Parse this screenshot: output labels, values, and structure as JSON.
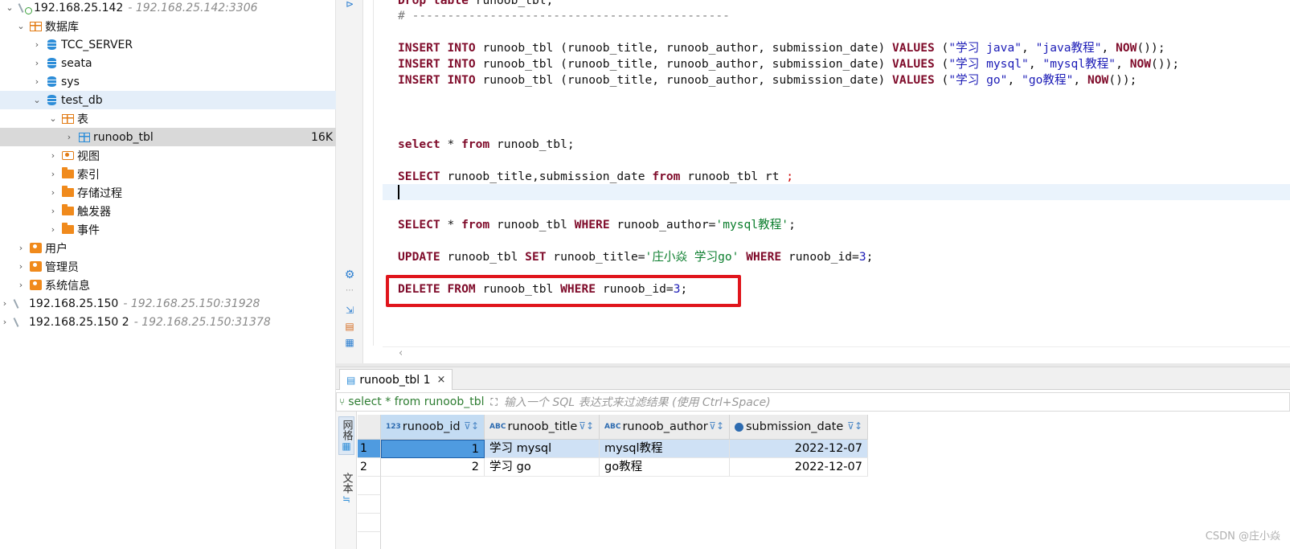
{
  "navigator": {
    "rows": [
      {
        "label": "192.168.25.142",
        "addr": "- 192.168.25.142:3306"
      },
      {
        "label": "数据库"
      },
      {
        "label": "TCC_SERVER"
      },
      {
        "label": "seata"
      },
      {
        "label": "sys"
      },
      {
        "label": "test_db"
      },
      {
        "label": "表"
      },
      {
        "label": "runoob_tbl",
        "size": "16K"
      },
      {
        "label": "视图"
      },
      {
        "label": "索引"
      },
      {
        "label": "存储过程"
      },
      {
        "label": "触发器"
      },
      {
        "label": "事件"
      },
      {
        "label": "用户"
      },
      {
        "label": "管理员"
      },
      {
        "label": "系统信息"
      },
      {
        "label": "192.168.25.150",
        "addr": "- 192.168.25.150:31928"
      },
      {
        "label": "192.168.25.150 2",
        "addr": "- 192.168.25.150:31378"
      }
    ]
  },
  "editor": {
    "line0": {
      "kw": "Drop table",
      "rest": " runoob_tbl;"
    },
    "line1": "# ---------------------------------------------",
    "insert": {
      "kw1": "INSERT INTO",
      "tbl": " runoob_tbl (runoob_title, runoob_author, submission_date) ",
      "kw2": "VALUES",
      "open": " (",
      "rows": [
        {
          "s1": "\"学习 java\"",
          "s2": "\"java教程\""
        },
        {
          "s1": "\"学习 mysql\"",
          "s2": "\"mysql教程\""
        },
        {
          "s1": "\"学习 go\"",
          "s2": "\"go教程\""
        }
      ],
      "sep": ", ",
      "now": "NOW",
      "close": "());"
    },
    "select_all": {
      "kw1": "select",
      "mid": " * ",
      "kw2": "from",
      "rest": " runoob_tbl;"
    },
    "select_cols": {
      "kw1": "SELECT",
      "mid": " runoob_title,submission_date ",
      "kw2": "from",
      "rest": " runoob_tbl rt ",
      "semi": ";"
    },
    "select_where": {
      "kw1": "SELECT",
      "mid": " * ",
      "kw2": "from",
      "tbl": " runoob_tbl ",
      "kw3": "WHERE",
      "col": " runoob_author=",
      "val": "'mysql教程'",
      "semi": ";"
    },
    "update": {
      "kw1": "UPDATE",
      "tbl": " runoob_tbl ",
      "kw2": "SET",
      "col": " runoob_title=",
      "val": "'庄小焱 学习go'",
      "sp": " ",
      "kw3": "WHERE",
      "col2": " runoob_id=",
      "num": "3",
      "semi": ";"
    },
    "delete": {
      "kw1": "DELETE FROM",
      "tbl": " runoob_tbl ",
      "kw2": "WHERE",
      "col": " runoob_id=",
      "num": "3",
      "semi": ";"
    }
  },
  "results": {
    "tab_label": "runoob_tbl 1",
    "tab_close": "×",
    "query": "select * from runoob_tbl",
    "filter_hint": "输入一个 SQL 表达式来过滤结果 (使用 Ctrl+Space)",
    "side_grid_label": "网格",
    "side_text_label": "文本",
    "columns": [
      {
        "type": "123",
        "name": "runoob_id"
      },
      {
        "type": "ABC",
        "name": "runoob_title"
      },
      {
        "type": "ABC",
        "name": "runoob_author"
      },
      {
        "type": "clock",
        "name": "submission_date"
      }
    ],
    "rows": [
      {
        "n": "1",
        "id": "1",
        "title": "学习 mysql",
        "author": "mysql教程",
        "date": "2022-12-07"
      },
      {
        "n": "2",
        "id": "2",
        "title": "学习 go",
        "author": "go教程",
        "date": "2022-12-07"
      }
    ]
  },
  "watermark": "CSDN @庄小焱",
  "colors": {
    "keyword": "#7f0b2a",
    "string": "#1b1bb6",
    "sqstring": "#0a7d2c",
    "highlight_box": "#e0151c",
    "selection": "#4f9be0"
  }
}
